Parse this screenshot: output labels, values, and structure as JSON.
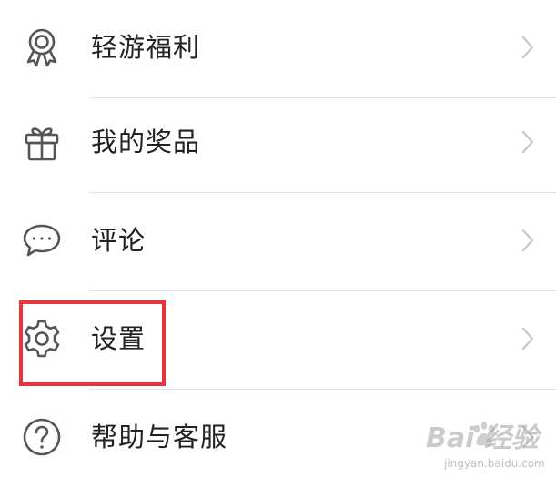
{
  "menu": {
    "items": [
      {
        "label": "轻游福利",
        "icon": "award-ribbon-icon"
      },
      {
        "label": "我的奖品",
        "icon": "gift-icon"
      },
      {
        "label": "评论",
        "icon": "comment-bubble-icon"
      },
      {
        "label": "设置",
        "icon": "gear-icon"
      },
      {
        "label": "帮助与客服",
        "icon": "help-circle-icon"
      }
    ]
  },
  "highlight": {
    "color": "#e8353b",
    "target": "设置"
  },
  "watermark": {
    "main": "Bai 经验",
    "sub": "jingyan.baidu.com"
  }
}
